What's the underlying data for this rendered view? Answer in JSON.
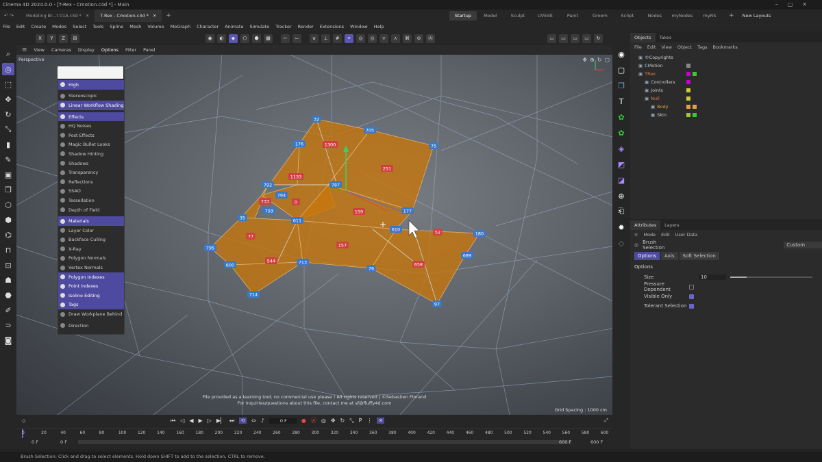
{
  "title_bar": {
    "text": "Cinema 4D 2024.0.0 - [T-Rex - Cmotion.c4d *] - Main"
  },
  "doc_tabs": [
    {
      "label": "Modeling Br...t 01A.c4d *"
    },
    {
      "label": "T-Rex - Cmotion.c4d *"
    }
  ],
  "layouts": [
    "Startup",
    "Model",
    "Sculpt",
    "UVEdit",
    "Paint",
    "Groom",
    "Script",
    "Nodes",
    "myNodes",
    "myRS"
  ],
  "new_layouts": "New Layouts",
  "menu": [
    "File",
    "Edit",
    "Create",
    "Modes",
    "Select",
    "Tools",
    "Spline",
    "Mesh",
    "Volume",
    "MoGraph",
    "Character",
    "Animate",
    "Simulate",
    "Tracker",
    "Render",
    "Extensions",
    "Window",
    "Help"
  ],
  "viewport_menu": [
    "View",
    "Cameras",
    "Display",
    "Options",
    "Filter",
    "Panel"
  ],
  "viewport_label": "Perspective",
  "grid_spacing": "Grid Spacing : 1000 cm",
  "watermark": [
    "File provided as a learning tool, no commercial use please !  All rights reserved  |  ©Sebastien Florand",
    "For inquiries/questions about this file, contact me at sf@fluffy4d.com"
  ],
  "options_menu": [
    {
      "label": "High",
      "on": true
    },
    {
      "sep": true
    },
    {
      "label": "Stereoscopic",
      "on": false
    },
    {
      "label": "Linear Workflow Shading",
      "on": true
    },
    {
      "sep": true
    },
    {
      "label": "Effects",
      "on": true
    },
    {
      "label": "HQ Noises",
      "on": false
    },
    {
      "label": "Post Effects",
      "on": false
    },
    {
      "label": "Magic Bullet Looks",
      "on": false
    },
    {
      "label": "Shadow Hinting",
      "on": false
    },
    {
      "label": "Shadows",
      "on": false
    },
    {
      "label": "Transparency",
      "on": false
    },
    {
      "label": "Reflections",
      "on": false
    },
    {
      "label": "SSAO",
      "on": false
    },
    {
      "label": "Tessellation",
      "on": false
    },
    {
      "label": "Depth of Field",
      "on": false
    },
    {
      "sep": true
    },
    {
      "label": "Materials",
      "on": true
    },
    {
      "label": "Layer Color",
      "on": false
    },
    {
      "label": "Backface Culling",
      "on": false
    },
    {
      "label": "X-Ray",
      "on": false
    },
    {
      "label": "Polygon Normals",
      "on": false
    },
    {
      "label": "Vertex Normals",
      "on": false
    },
    {
      "label": "Polygon Indexes",
      "on": true
    },
    {
      "label": "Point Indexes",
      "on": true
    },
    {
      "label": "Isoline Editing",
      "on": true
    },
    {
      "label": "Tags",
      "on": true
    },
    {
      "label": "Draw Workplane Behind",
      "on": false
    },
    {
      "sep": true
    },
    {
      "label": "Direction",
      "on": false
    }
  ],
  "point_labels": [
    "32",
    "705",
    "176",
    "1300",
    "75",
    "251",
    "792",
    "1133",
    "787",
    "733",
    "794",
    "0",
    "793",
    "159",
    "177",
    "35",
    "611",
    "610",
    "52",
    "180",
    "77",
    "157",
    "795",
    "544",
    "713",
    "600",
    "658",
    "76",
    "689",
    "714",
    "97"
  ],
  "objects_panel": {
    "tabs": [
      "Objects",
      "Takes"
    ],
    "menu": [
      "File",
      "Edit",
      "View",
      "Object",
      "Tags",
      "Bookmarks"
    ],
    "rows": [
      {
        "name": "©Copyrights",
        "indent": 0,
        "color": "#cccccc"
      },
      {
        "name": "CMotion",
        "indent": 0,
        "color": "#cccccc"
      },
      {
        "name": "TRex",
        "indent": 0,
        "color": "#e07a50"
      },
      {
        "name": "Controllers",
        "indent": 1,
        "color": "#cccccc"
      },
      {
        "name": "Joints",
        "indent": 1,
        "color": "#cccccc"
      },
      {
        "name": "Null",
        "indent": 1,
        "color": "#e07a50"
      },
      {
        "name": "Body",
        "indent": 2,
        "color": "#e0a040"
      },
      {
        "name": "Skin",
        "indent": 2,
        "color": "#cccccc"
      }
    ]
  },
  "attributes_panel": {
    "tabs": [
      "Attributes",
      "Layers"
    ],
    "menu": [
      "Mode",
      "Edit",
      "User Data"
    ],
    "tool_name": "Brush Selection",
    "preset": "Custom",
    "subtabs": [
      "Options",
      "Axis",
      "Soft Selection"
    ],
    "section": "Options",
    "fields": {
      "size_label": "Size",
      "size_value": "10",
      "pressure_label": "Pressure Dependent",
      "visible_label": "Visible Only",
      "tolerant_label": "Tolerant Selection"
    },
    "size_fraction": 0.2
  },
  "timeline": {
    "ticks": [
      "0",
      "20",
      "40",
      "60",
      "80",
      "100",
      "120",
      "140",
      "160",
      "180",
      "200",
      "220",
      "240",
      "260",
      "280",
      "300",
      "320",
      "340",
      "360",
      "380",
      "400",
      "420",
      "440",
      "460",
      "480",
      "500",
      "520",
      "540",
      "560",
      "580",
      "600"
    ],
    "current_frame": "0 F",
    "start": "0 F",
    "start2": "0 F",
    "end": "600 F",
    "end2": "600 F"
  },
  "status_text": "Brush Selection: Click and drag to select elements. Hold down SHIFT to add to the selection, CTRL to remove.",
  "accent": "#5a55b0",
  "selection_color": "#c8760a"
}
